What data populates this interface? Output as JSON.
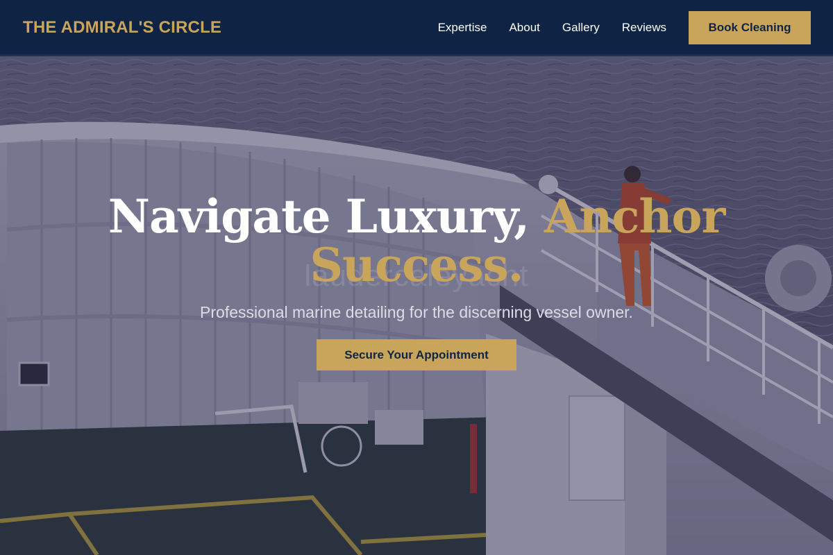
{
  "header": {
    "brand": "THE ADMIRAL'S CIRCLE",
    "nav": [
      {
        "label": "Expertise"
      },
      {
        "label": "About"
      },
      {
        "label": "Gallery"
      },
      {
        "label": "Reviews"
      }
    ],
    "cta_label": "Book Cleaning"
  },
  "hero": {
    "headline_part1": "Navigate Luxury, ",
    "headline_part2": "Anchor Success.",
    "ghost_text": "laudercaleyacht",
    "subheadline": "Professional marine detailing for the discerning vessel owner.",
    "cta_label": "Secure Your Appointment",
    "background": "ship-deck-at-sea-photo"
  },
  "colors": {
    "navy": "#0f2444",
    "gold": "#c9a55c",
    "white": "#ffffff"
  }
}
